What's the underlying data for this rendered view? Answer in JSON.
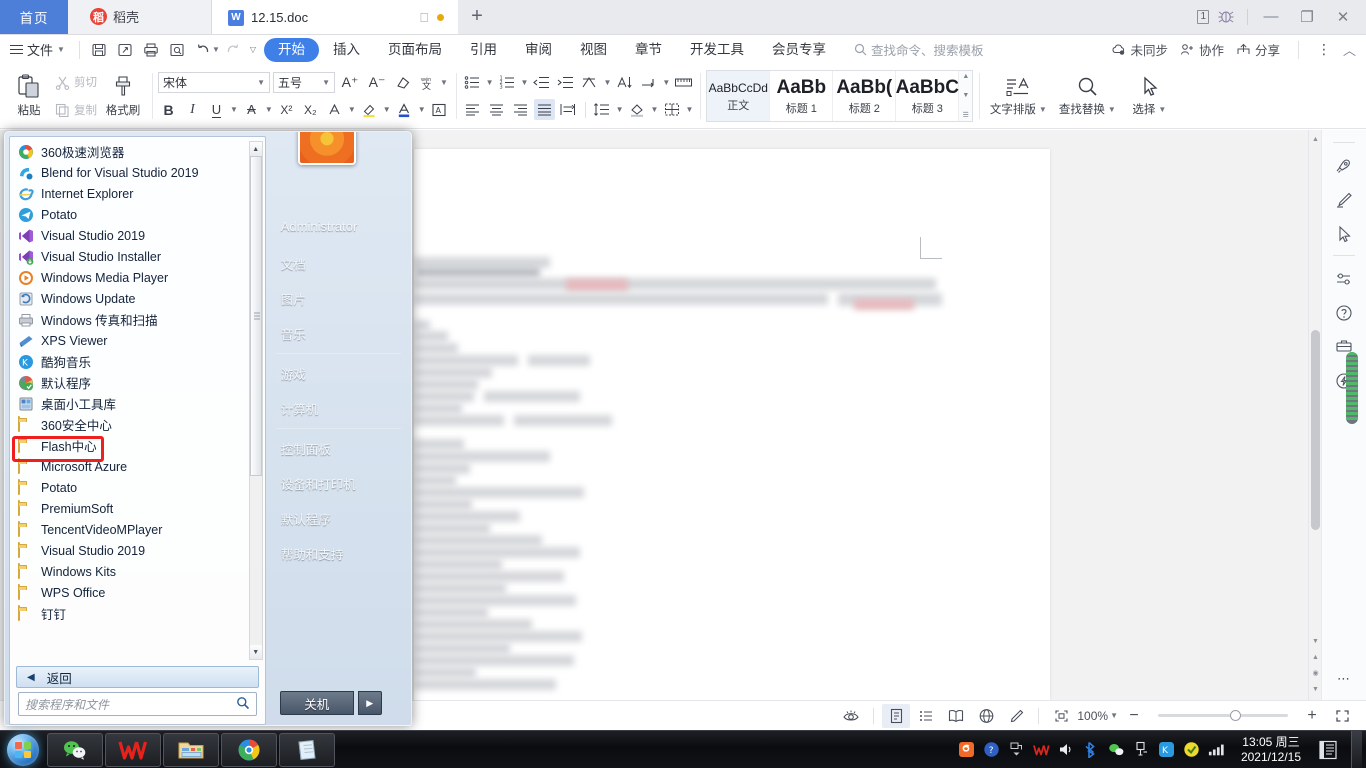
{
  "window": {
    "tabs": [
      {
        "label": "首页",
        "name": "tab-home"
      },
      {
        "label": "稻壳",
        "name": "tab-daoke",
        "icon": "daoke-icon"
      },
      {
        "label": "12.15.doc",
        "name": "tab-document",
        "icon": "wps-doc-icon",
        "modified": true
      }
    ],
    "new_tab_label": "+",
    "page_count_badge": "1",
    "minimize": "—",
    "maximize": "❐",
    "close": "✕"
  },
  "menubar": {
    "file_label": "文件",
    "quick_access": [
      "save-icon",
      "save-as-icon",
      "print-icon",
      "print-preview-icon",
      "undo-icon",
      "redo-icon",
      "customize-icon"
    ],
    "ribbon_tabs": [
      {
        "label": "开始",
        "active": true
      },
      {
        "label": "插入",
        "active": false
      },
      {
        "label": "页面布局",
        "active": false
      },
      {
        "label": "引用",
        "active": false
      },
      {
        "label": "审阅",
        "active": false
      },
      {
        "label": "视图",
        "active": false
      },
      {
        "label": "章节",
        "active": false
      },
      {
        "label": "开发工具",
        "active": false
      },
      {
        "label": "会员专享",
        "active": false
      }
    ],
    "search_placeholder": "查找命令、搜索模板",
    "right_items": [
      {
        "label": "未同步",
        "icon": "cloud-sync-icon"
      },
      {
        "label": "协作",
        "icon": "collaborate-icon"
      },
      {
        "label": "分享",
        "icon": "share-icon"
      }
    ],
    "more_label": "⋮",
    "collapse_label": "︿"
  },
  "ribbon": {
    "clipboard": {
      "paste_label": "粘贴",
      "cut_label": "剪切",
      "copy_label": "复制",
      "format_painter_label": "格式刷"
    },
    "font": {
      "family": "宋体",
      "size": "五号",
      "grow_label": "A⁺",
      "shrink_label": "A⁻",
      "clear_format": "clear-format-icon",
      "pinyin_label": "拼音指南",
      "bold": "B",
      "italic": "I",
      "underline": "U",
      "strikethrough": "A",
      "superscript": "X²",
      "subscript": "X₂",
      "char_border": "A",
      "highlight": "highlight-icon",
      "font_color": "font-color-icon",
      "char_shading": "char-shading-icon"
    },
    "paragraph": {
      "bullets": "bullet-list-icon",
      "numbering": "numbered-list-icon",
      "decrease_indent": "decrease-indent-icon",
      "increase_indent": "increase-indent-icon",
      "asian_layout": "asian-layout-icon",
      "sort": "sort-icon",
      "show_marks": "show-paragraph-marks-icon",
      "ruler": "ruler-icon",
      "align_left": "align-left-icon",
      "align_center": "align-center-icon",
      "align_right": "align-right-icon",
      "align_justify": "align-justify-icon",
      "distribute": "distribute-icon",
      "line_spacing": "line-spacing-icon",
      "shading": "shading-icon",
      "borders": "borders-icon"
    },
    "styles": [
      {
        "preview": "AaBbCcDd",
        "name": "正文",
        "selected": true,
        "big": false
      },
      {
        "preview": "AaBb",
        "name": "标题 1",
        "selected": false,
        "big": true
      },
      {
        "preview": "AaBb(",
        "name": "标题 2",
        "selected": false,
        "big": true
      },
      {
        "preview": "AaBbC",
        "name": "标题 3",
        "selected": false,
        "big": true
      }
    ],
    "tools": [
      {
        "label": "文字排版",
        "icon": "text-layout-icon"
      },
      {
        "label": "查找替换",
        "icon": "find-replace-icon"
      },
      {
        "label": "选择",
        "icon": "select-icon"
      }
    ]
  },
  "statusbar": {
    "eye_icon": "reading-eye-icon",
    "views": [
      "page-view-icon",
      "outline-view-icon",
      "reading-view-icon",
      "web-view-icon",
      "edit-view-icon"
    ],
    "fit_icon": "fit-page-icon",
    "zoom_value": "100%",
    "zoom_out": "−",
    "zoom_in": "+",
    "fullscreen_icon": "fullscreen-icon"
  },
  "rail": {
    "icons": [
      "rocket-icon",
      "brush-icon",
      "cursor-icon",
      "settings-sliders-icon",
      "help-icon",
      "toolbox-icon",
      "flash-icon"
    ],
    "more_label": "⋯",
    "expand_icon": "expand-icon"
  },
  "start_menu": {
    "programs": [
      {
        "label": "360极速浏览器",
        "icon": "chrome360-icon",
        "type": "app"
      },
      {
        "label": "Blend for Visual Studio 2019",
        "icon": "blend-icon",
        "type": "app"
      },
      {
        "label": "Internet Explorer",
        "icon": "ie-icon",
        "type": "app"
      },
      {
        "label": "Potato",
        "icon": "potato-icon",
        "type": "app"
      },
      {
        "label": "Visual Studio 2019",
        "icon": "vs-icon",
        "type": "app"
      },
      {
        "label": "Visual Studio Installer",
        "icon": "vs-installer-icon",
        "type": "app"
      },
      {
        "label": "Windows Media Player",
        "icon": "wmp-icon",
        "type": "app"
      },
      {
        "label": "Windows Update",
        "icon": "windows-update-icon",
        "type": "app"
      },
      {
        "label": "Windows 传真和扫描",
        "icon": "fax-scan-icon",
        "type": "app"
      },
      {
        "label": "XPS Viewer",
        "icon": "xps-icon",
        "type": "app"
      },
      {
        "label": "酷狗音乐",
        "icon": "kugou-icon",
        "type": "app"
      },
      {
        "label": "默认程序",
        "icon": "default-programs-icon",
        "type": "app"
      },
      {
        "label": "桌面小工具库",
        "icon": "gadgets-icon",
        "type": "app"
      },
      {
        "label": "360安全中心",
        "icon": "folder-icon",
        "type": "folder"
      },
      {
        "label": "Flash中心",
        "icon": "folder-icon",
        "type": "folder",
        "highlighted": true
      },
      {
        "label": "Microsoft Azure",
        "icon": "folder-icon",
        "type": "folder"
      },
      {
        "label": "Potato",
        "icon": "folder-icon",
        "type": "folder"
      },
      {
        "label": "PremiumSoft",
        "icon": "folder-icon",
        "type": "folder"
      },
      {
        "label": "TencentVideoMPlayer",
        "icon": "folder-icon",
        "type": "folder"
      },
      {
        "label": "Visual Studio 2019",
        "icon": "folder-icon",
        "type": "folder"
      },
      {
        "label": "Windows Kits",
        "icon": "folder-icon",
        "type": "folder"
      },
      {
        "label": "WPS Office",
        "icon": "folder-icon",
        "type": "folder"
      },
      {
        "label": "钉钉",
        "icon": "folder-icon",
        "type": "folder"
      }
    ],
    "back_label": "返回",
    "search_placeholder": "搜索程序和文件",
    "user_name": "Administrator",
    "right_items": [
      {
        "label": "文档",
        "group": 1
      },
      {
        "label": "图片",
        "group": 1
      },
      {
        "label": "音乐",
        "group": 1
      },
      {
        "label": "游戏",
        "group": 2
      },
      {
        "label": "计算机",
        "group": 2
      },
      {
        "label": "控制面板",
        "group": 3
      },
      {
        "label": "设备和打印机",
        "group": 3
      },
      {
        "label": "默认程序",
        "group": 3
      },
      {
        "label": "帮助和支持",
        "group": 3
      }
    ],
    "shutdown_label": "关机",
    "shutdown_arrow": "▶",
    "highlight_color": "#f01f1f"
  },
  "taskbar": {
    "start_orb": "windows-start-orb",
    "pinned": [
      {
        "name": "wechat-taskbar-icon"
      },
      {
        "name": "wps-taskbar-icon"
      },
      {
        "name": "file-explorer-taskbar-icon"
      },
      {
        "name": "chrome-taskbar-icon"
      },
      {
        "name": "notepad-taskbar-icon"
      }
    ],
    "tray_icons": [
      "sogou-input-icon",
      "help-icon",
      "expand-tray-icon",
      "wps-tray-icon",
      "volume-icon",
      "bluetooth-icon",
      "wechat-tray-icon",
      "usb-eject-icon",
      "kugou-tray-icon",
      "360-tray-icon",
      "network-signal-icon"
    ],
    "clock_time": "13:05 周三",
    "clock_date": "2021/12/15",
    "action_center": "action-center-icon",
    "show_desktop": "show-desktop-button"
  }
}
